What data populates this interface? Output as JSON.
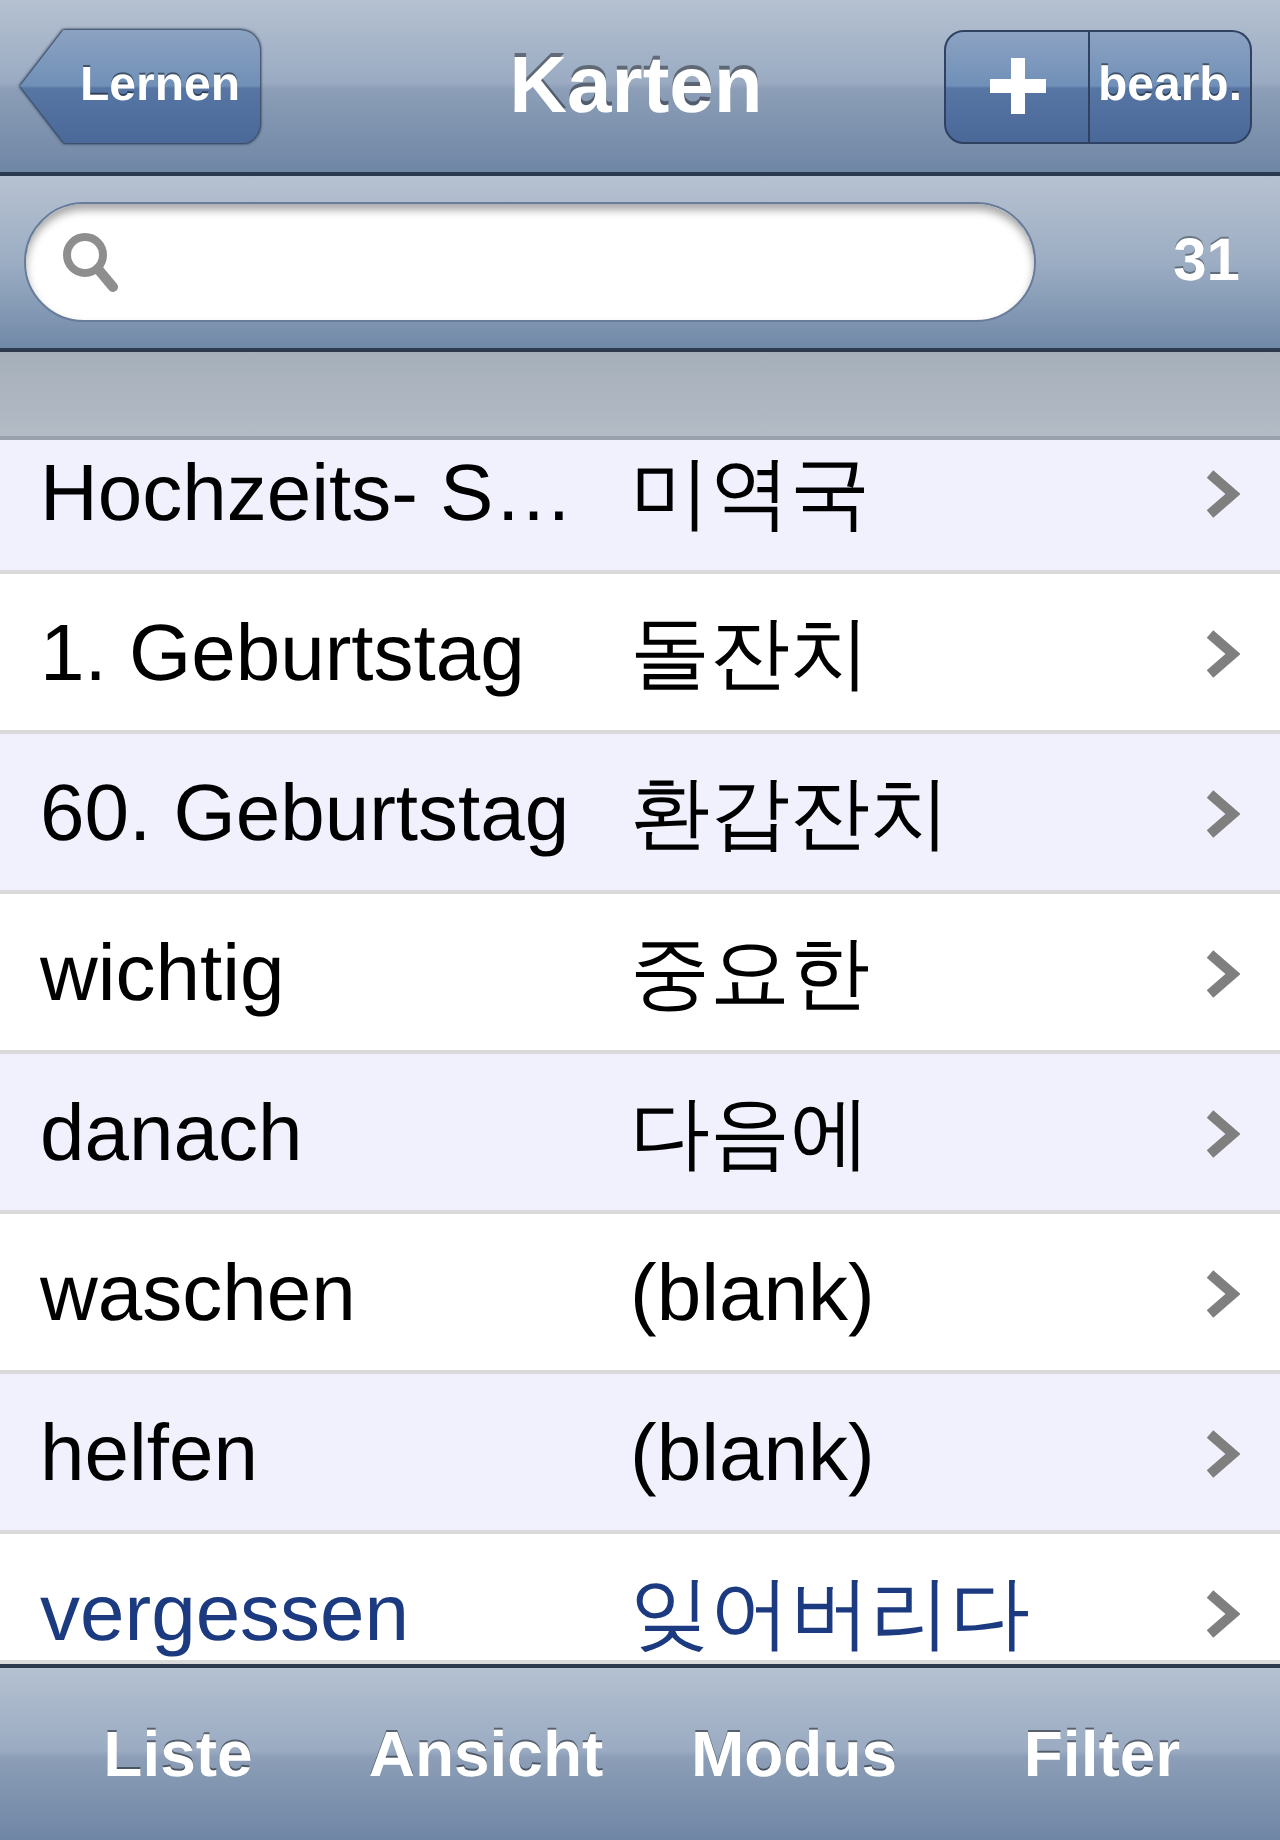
{
  "nav_bar": {
    "back_button": "Lernen",
    "title": "Karten",
    "edit_button": "bearb."
  },
  "search": {
    "count": "31"
  },
  "cards": [
    {
      "term": "Hochzeits- S…",
      "translation": "미역국",
      "highlighted": false
    },
    {
      "term": "1. Geburtstag",
      "translation": "돌잔치",
      "highlighted": false
    },
    {
      "term": "60. Geburtstag",
      "translation": "환갑잔치",
      "highlighted": false
    },
    {
      "term": "wichtig",
      "translation": "중요한",
      "highlighted": false
    },
    {
      "term": "danach",
      "translation": "다음에",
      "highlighted": false
    },
    {
      "term": "waschen",
      "translation": "(blank)",
      "highlighted": false
    },
    {
      "term": "helfen",
      "translation": "(blank)",
      "highlighted": false
    },
    {
      "term": "vergessen",
      "translation": "잊어버리다",
      "highlighted": true
    }
  ],
  "toolbar": {
    "buttons": [
      "Liste",
      "Ansicht",
      "Modus",
      "Filter"
    ]
  }
}
